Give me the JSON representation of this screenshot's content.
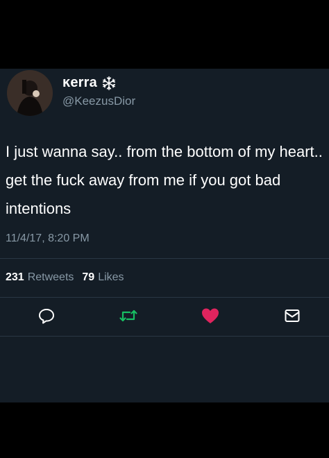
{
  "tweet": {
    "display_name": "ĸerra",
    "handle": "@KeezusDior",
    "text": "I just wanna say.. from the bottom of my heart.. get the fuck away from me if you got bad intentions",
    "timestamp": "11/4/17, 8:20 PM"
  },
  "stats": {
    "retweets_count": "231",
    "retweets_label": "Retweets",
    "likes_count": "79",
    "likes_label": "Likes"
  },
  "colors": {
    "background": "#141d26",
    "secondary_text": "#8899a6",
    "retweet_green": "#17bf63",
    "like_red": "#e0245e"
  },
  "icons": [
    "snowflake-icon",
    "reply-icon",
    "retweet-icon",
    "like-icon",
    "message-icon"
  ]
}
